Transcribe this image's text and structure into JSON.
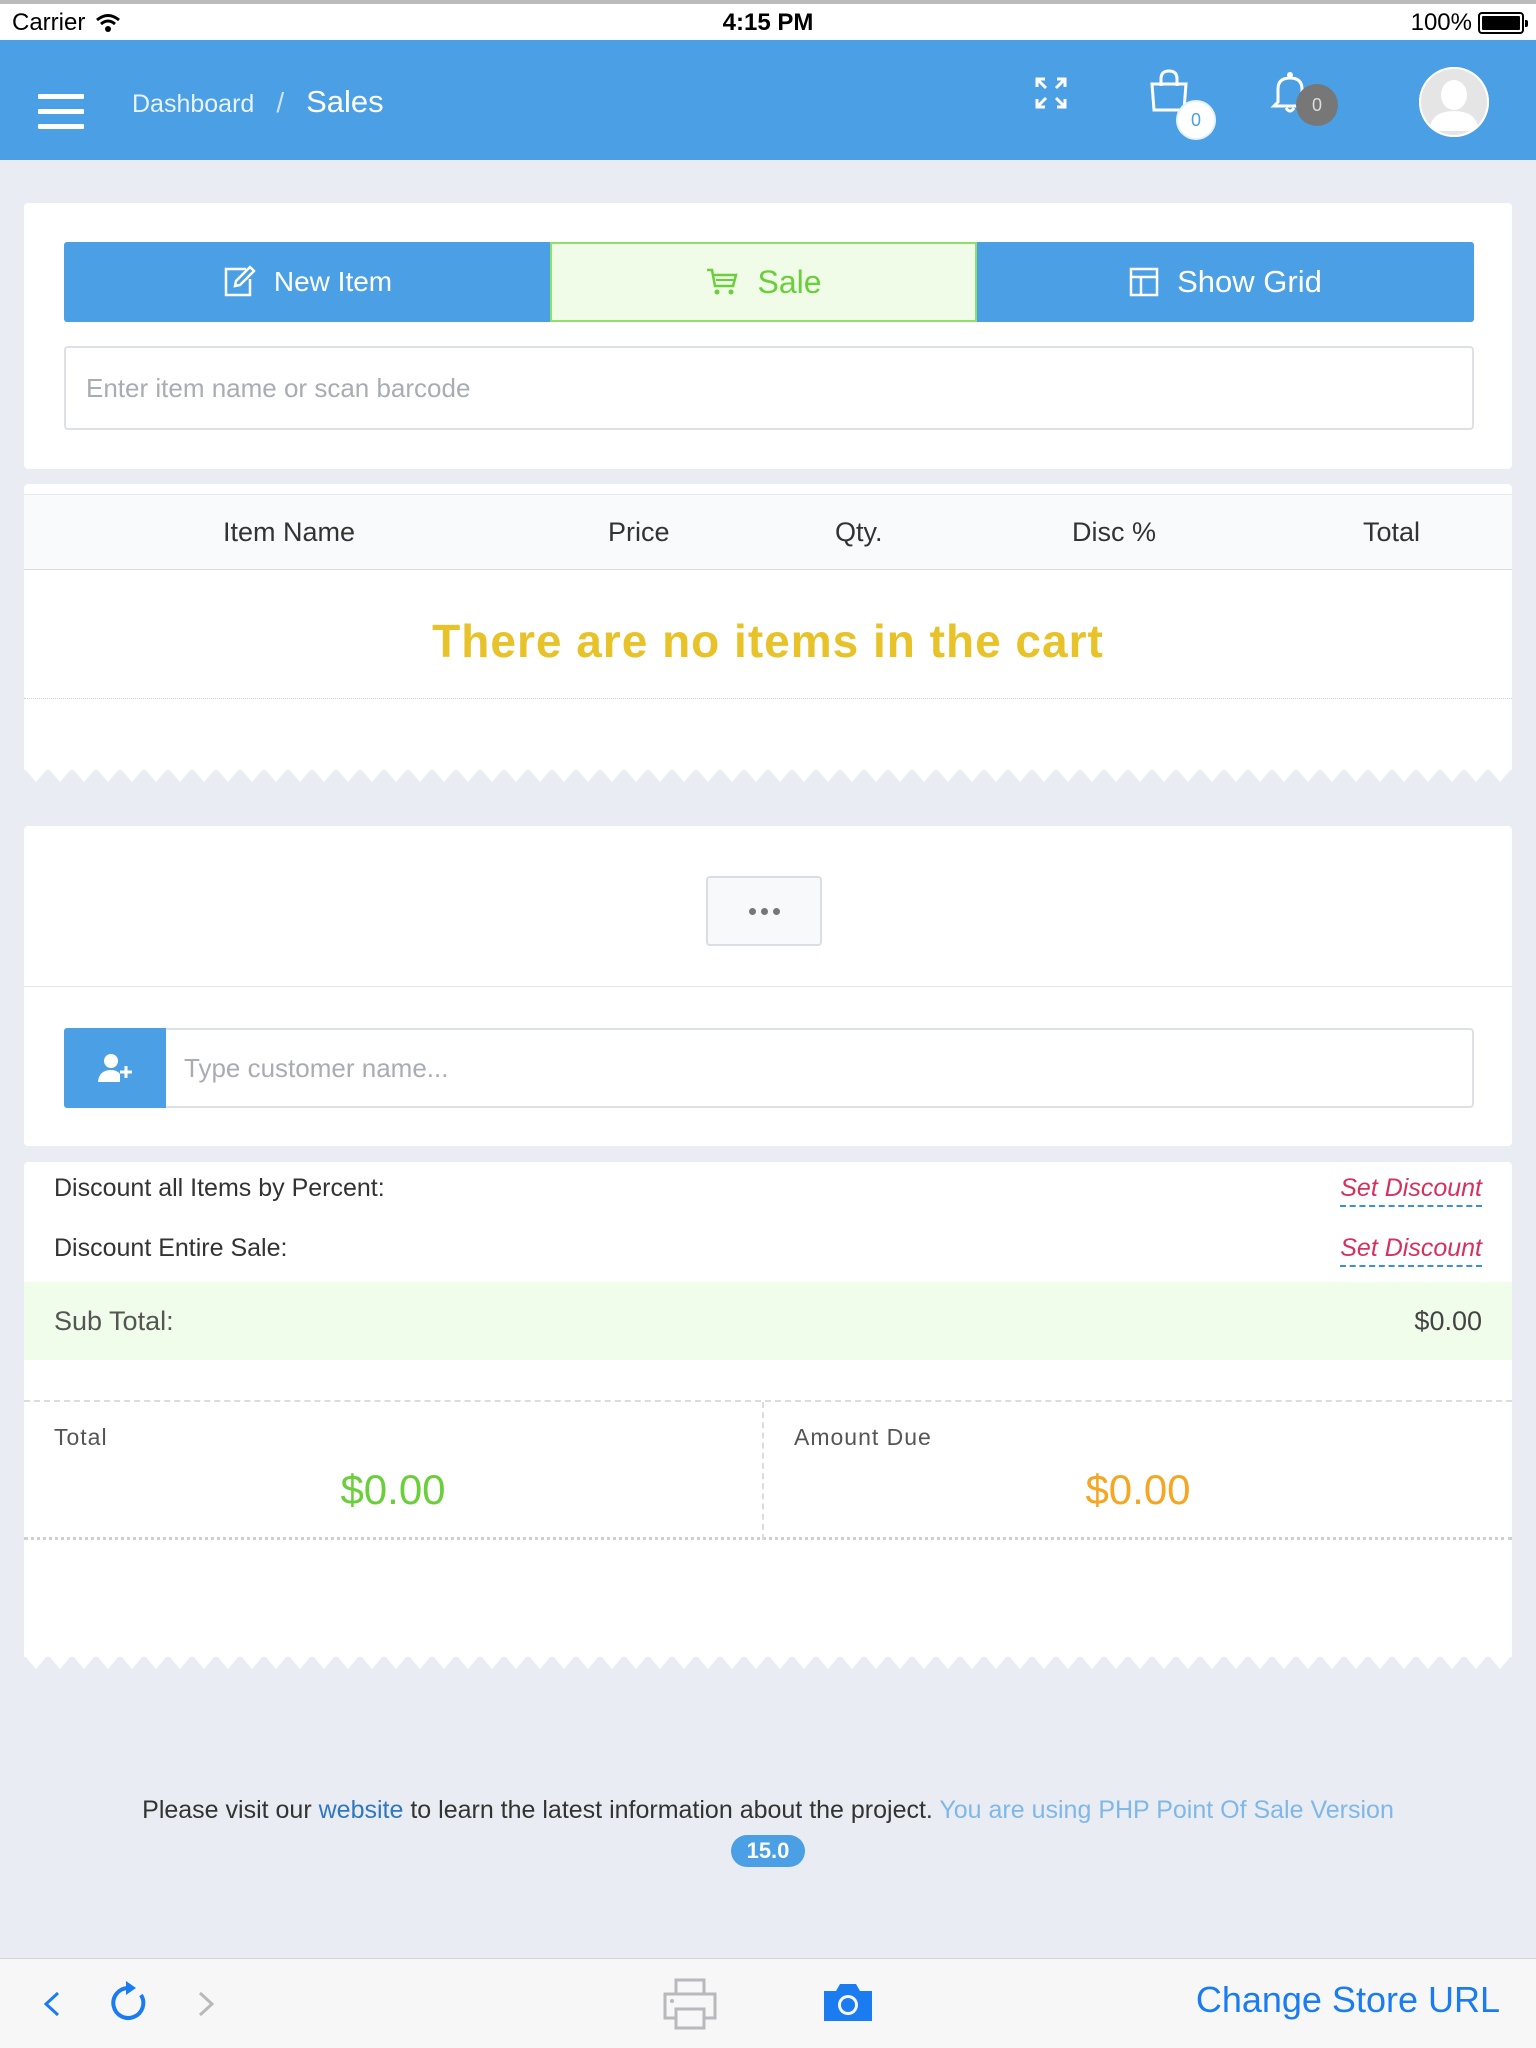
{
  "status_bar": {
    "carrier": "Carrier",
    "time": "4:15 PM",
    "battery": "100%"
  },
  "header": {
    "breadcrumb": {
      "parent": "Dashboard",
      "separator": "/",
      "current": "Sales"
    },
    "cart_count": "0",
    "notification_count": "0"
  },
  "toolbar": {
    "new_item_label": "New Item",
    "sale_label": "Sale",
    "show_grid_label": "Show Grid"
  },
  "search": {
    "placeholder": "Enter item name or scan barcode"
  },
  "cart": {
    "columns": [
      "Item Name",
      "Price",
      "Qty.",
      "Disc %",
      "Total"
    ],
    "empty_message": "There are no items in the cart"
  },
  "customer": {
    "placeholder": "Type customer name..."
  },
  "discounts": {
    "percent_label": "Discount all Items by Percent:",
    "percent_link": "Set Discount",
    "entire_label": "Discount Entire Sale:",
    "entire_link": "Set Discount"
  },
  "summary": {
    "subtotal_label": "Sub Total:",
    "subtotal_value": "$0.00",
    "total_label": "Total",
    "total_value": "$0.00",
    "amount_due_label": "Amount Due",
    "amount_due_value": "$0.00"
  },
  "footer": {
    "text_before": "Please visit our",
    "link_text": "website",
    "text_after": "to learn the latest information about the project.",
    "version_text": "You are using PHP Point Of Sale Version",
    "version_number": "15.0"
  },
  "bottom_bar": {
    "change_store_label": "Change Store URL"
  },
  "colors": {
    "primary": "#4a9fe5",
    "sale_green": "#6bcf3b",
    "empty_yellow": "#e8c229",
    "total_green": "#6bcf3b",
    "due_orange": "#f5a623",
    "discount_link": "#d6315e"
  }
}
